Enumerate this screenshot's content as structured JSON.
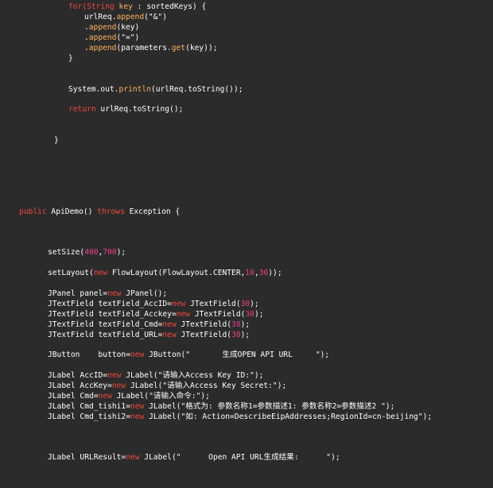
{
  "colors": {
    "background": "#2b2b2b",
    "text": "#ffffff",
    "keyword": "#f2483a",
    "method": "#ffb35c",
    "number": "#ef3e8c"
  },
  "code_lines": [
    {
      "tokens": [
        {
          "t": "for(",
          "k": "kw"
        },
        {
          "t": "String",
          "k": "kw"
        },
        {
          "t": " ",
          "k": "plain"
        },
        {
          "t": "key",
          "k": "fn"
        },
        {
          "t": " : sortedKeys) {",
          "k": "plain"
        }
      ]
    },
    {
      "tokens": [
        {
          "t": "urlReq.",
          "k": "plain"
        },
        {
          "t": "append",
          "k": "fn"
        },
        {
          "t": "(\"&\")",
          "k": "plain"
        }
      ]
    },
    {
      "tokens": [
        {
          "t": ".",
          "k": "plain"
        },
        {
          "t": "append",
          "k": "fn"
        },
        {
          "t": "(key)",
          "k": "plain"
        }
      ]
    },
    {
      "tokens": [
        {
          "t": ".",
          "k": "plain"
        },
        {
          "t": "append",
          "k": "fn"
        },
        {
          "t": "(\"=\")",
          "k": "plain"
        }
      ]
    },
    {
      "tokens": [
        {
          "t": ".",
          "k": "plain"
        },
        {
          "t": "append",
          "k": "fn"
        },
        {
          "t": "(parameters.",
          "k": "plain"
        },
        {
          "t": "get",
          "k": "fn"
        },
        {
          "t": "(key));",
          "k": "plain"
        }
      ]
    },
    {
      "tokens": [
        {
          "t": "}",
          "k": "plain"
        }
      ]
    },
    {
      "tokens": [
        {
          "t": "System.out.",
          "k": "plain"
        },
        {
          "t": "println",
          "k": "fn"
        },
        {
          "t": "(urlReq.toString());",
          "k": "plain"
        }
      ]
    },
    {
      "tokens": [
        {
          "t": "return",
          "k": "kw"
        },
        {
          "t": " urlReq.toString();",
          "k": "plain"
        }
      ]
    },
    {
      "tokens": [
        {
          "t": "}",
          "k": "plain"
        }
      ]
    },
    {
      "tokens": [
        {
          "t": "public",
          "k": "kw"
        },
        {
          "t": " ApiDemo() ",
          "k": "plain"
        },
        {
          "t": "throws",
          "k": "kw"
        },
        {
          "t": " Exception {",
          "k": "plain"
        }
      ]
    },
    {
      "tokens": [
        {
          "t": "setSize(",
          "k": "plain"
        },
        {
          "t": "400",
          "k": "num"
        },
        {
          "t": ",",
          "k": "plain"
        },
        {
          "t": "700",
          "k": "num"
        },
        {
          "t": ");",
          "k": "plain"
        }
      ]
    },
    {
      "tokens": [
        {
          "t": "setLayout(",
          "k": "plain"
        },
        {
          "t": "new",
          "k": "kw"
        },
        {
          "t": " FlowLayout(FlowLayout.CENTER,",
          "k": "plain"
        },
        {
          "t": "10",
          "k": "num"
        },
        {
          "t": ",",
          "k": "plain"
        },
        {
          "t": "30",
          "k": "num"
        },
        {
          "t": "));",
          "k": "plain"
        }
      ]
    },
    {
      "tokens": [
        {
          "t": "JPanel panel=",
          "k": "plain"
        },
        {
          "t": "new",
          "k": "kw"
        },
        {
          "t": " JPanel();",
          "k": "plain"
        }
      ]
    },
    {
      "tokens": [
        {
          "t": "JTextField textField_AccID=",
          "k": "plain"
        },
        {
          "t": "new",
          "k": "kw"
        },
        {
          "t": " JTextField(",
          "k": "plain"
        },
        {
          "t": "30",
          "k": "num"
        },
        {
          "t": ");",
          "k": "plain"
        }
      ]
    },
    {
      "tokens": [
        {
          "t": "JTextField textField_Acckey=",
          "k": "plain"
        },
        {
          "t": "new",
          "k": "kw"
        },
        {
          "t": " JTextField(",
          "k": "plain"
        },
        {
          "t": "30",
          "k": "num"
        },
        {
          "t": ");",
          "k": "plain"
        }
      ]
    },
    {
      "tokens": [
        {
          "t": "JTextField textField_Cmd=",
          "k": "plain"
        },
        {
          "t": "new",
          "k": "kw"
        },
        {
          "t": " JTextField(",
          "k": "plain"
        },
        {
          "t": "30",
          "k": "num"
        },
        {
          "t": ");",
          "k": "plain"
        }
      ]
    },
    {
      "tokens": [
        {
          "t": "JTextField textField_URL=",
          "k": "plain"
        },
        {
          "t": "new",
          "k": "kw"
        },
        {
          "t": " JTextField(",
          "k": "plain"
        },
        {
          "t": "30",
          "k": "num"
        },
        {
          "t": ");",
          "k": "plain"
        }
      ]
    },
    {
      "tokens": [
        {
          "t": "JButton    button=",
          "k": "plain"
        },
        {
          "t": "new",
          "k": "kw"
        },
        {
          "t": " JButton(\"       生成OPEN API URL     \");",
          "k": "plain"
        }
      ]
    },
    {
      "tokens": [
        {
          "t": "JLabel AccID=",
          "k": "plain"
        },
        {
          "t": "new",
          "k": "kw"
        },
        {
          "t": " JLabel(\"请输入Access Key ID:\");",
          "k": "plain"
        }
      ]
    },
    {
      "tokens": [
        {
          "t": "JLabel AccKey=",
          "k": "plain"
        },
        {
          "t": "new",
          "k": "kw"
        },
        {
          "t": " JLabel(\"请输入Access Key Secret:\");",
          "k": "plain"
        }
      ]
    },
    {
      "tokens": [
        {
          "t": "JLabel Cmd=",
          "k": "plain"
        },
        {
          "t": "new",
          "k": "kw"
        },
        {
          "t": " JLabel(\"请输入命令:\");",
          "k": "plain"
        }
      ]
    },
    {
      "tokens": [
        {
          "t": "JLabel Cmd_tishi1=",
          "k": "plain"
        },
        {
          "t": "new",
          "k": "kw"
        },
        {
          "t": " JLabel(\"格式为: 参数名称1=参数描述1: 参数名称2=参数描述2 \");",
          "k": "plain"
        }
      ]
    },
    {
      "tokens": [
        {
          "t": "JLabel Cmd_tishi2=",
          "k": "plain"
        },
        {
          "t": "new",
          "k": "kw"
        },
        {
          "t": " JLabel(\"如: Action=DescribeEipAddresses;RegionId=cn-beijing\");",
          "k": "plain"
        }
      ]
    },
    {
      "tokens": [
        {
          "t": "JLabel URLResult=",
          "k": "plain"
        },
        {
          "t": "new",
          "k": "kw"
        },
        {
          "t": " JLabel(\"      Open API URL生成结果:      \");",
          "k": "plain"
        }
      ]
    }
  ]
}
